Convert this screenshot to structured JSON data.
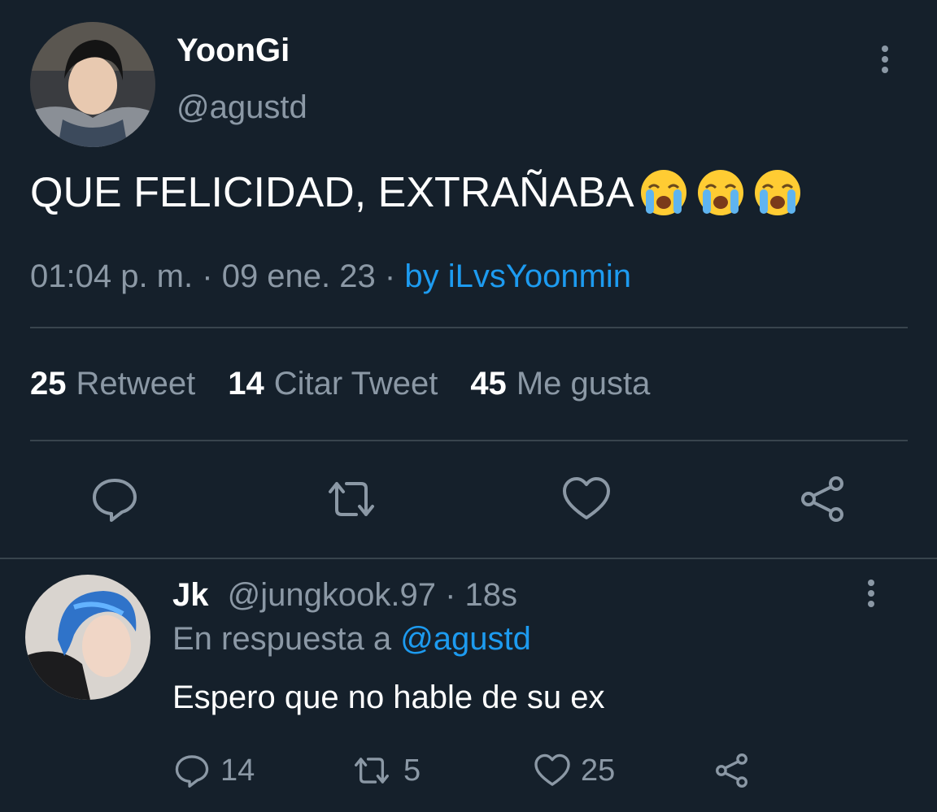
{
  "tweet": {
    "author_name": "YoonGi",
    "author_handle": "@agustd",
    "text": "QUE FELICIDAD, EXTRAÑABA",
    "emoji": "loudly-crying-face x3",
    "time": "01:04 p. m.",
    "date": "09 ene. 23",
    "via": "by iLvsYoonmin",
    "separator": "·",
    "stats": {
      "retweets_count": "25",
      "retweets_label": "Retweet",
      "quotes_count": "14",
      "quotes_label": "Citar Tweet",
      "likes_count": "45",
      "likes_label": "Me gusta"
    },
    "actions": [
      "reply-icon",
      "retweet-icon",
      "like-icon",
      "share-icon"
    ]
  },
  "reply": {
    "author_name": "Jk",
    "author_handle": "@jungkook.97",
    "time": "18s",
    "reply_prefix": "En respuesta a",
    "reply_mention": "@agustd",
    "text": "Espero que no hable de su ex",
    "replies_count": "14",
    "retweets_count": "5",
    "likes_count": "25"
  },
  "colors": {
    "background": "#15202b",
    "primary_text": "#ffffff",
    "secondary_text": "#8b98a5",
    "accent": "#1d9bf0",
    "divider": "#38444d"
  }
}
